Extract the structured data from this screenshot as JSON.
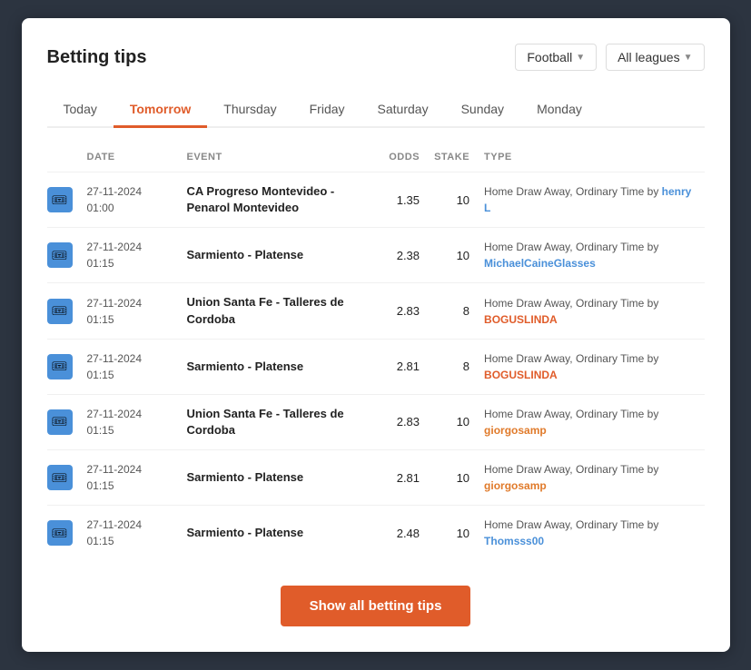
{
  "header": {
    "title": "Betting tips",
    "filters": {
      "league_label": "Football",
      "allleagues_label": "All leagues"
    }
  },
  "tabs": [
    {
      "id": "today",
      "label": "Today",
      "active": false
    },
    {
      "id": "tomorrow",
      "label": "Tomorrow",
      "active": true
    },
    {
      "id": "thursday",
      "label": "Thursday",
      "active": false
    },
    {
      "id": "friday",
      "label": "Friday",
      "active": false
    },
    {
      "id": "saturday",
      "label": "Saturday",
      "active": false
    },
    {
      "id": "sunday",
      "label": "Sunday",
      "active": false
    },
    {
      "id": "monday",
      "label": "Monday",
      "active": false
    }
  ],
  "table": {
    "columns": [
      "DATE",
      "EVENT",
      "ODDS",
      "STAKE",
      "TYPE"
    ],
    "rows": [
      {
        "date": "27-11-2024",
        "time": "01:00",
        "event": "CA Progreso Montevideo - Penarol Montevideo",
        "odds": "1.35",
        "stake": "10",
        "type_prefix": "Home Draw Away, Ordinary Time by ",
        "author": "henry L",
        "author_color": "blue"
      },
      {
        "date": "27-11-2024",
        "time": "01:15",
        "event": "Sarmiento - Platense",
        "odds": "2.38",
        "stake": "10",
        "type_prefix": "Home Draw Away, Ordinary Time by ",
        "author": "MichaelCaineGlasses",
        "author_color": "blue"
      },
      {
        "date": "27-11-2024",
        "time": "01:15",
        "event": "Union Santa Fe - Talleres de Cordoba",
        "odds": "2.83",
        "stake": "8",
        "type_prefix": "Home Draw Away, Ordinary Time by ",
        "author": "BOGUSLINDA",
        "author_color": "red"
      },
      {
        "date": "27-11-2024",
        "time": "01:15",
        "event": "Sarmiento - Platense",
        "odds": "2.81",
        "stake": "8",
        "type_prefix": "Home Draw Away, Ordinary Time by ",
        "author": "BOGUSLINDA",
        "author_color": "red"
      },
      {
        "date": "27-11-2024",
        "time": "01:15",
        "event": "Union Santa Fe - Talleres de Cordoba",
        "odds": "2.83",
        "stake": "10",
        "type_prefix": "Home Draw Away, Ordinary Time by ",
        "author": "giorgosamp",
        "author_color": "orange"
      },
      {
        "date": "27-11-2024",
        "time": "01:15",
        "event": "Sarmiento - Platense",
        "odds": "2.81",
        "stake": "10",
        "type_prefix": "Home Draw Away, Ordinary Time by ",
        "author": "giorgosamp",
        "author_color": "orange"
      },
      {
        "date": "27-11-2024",
        "time": "01:15",
        "event": "Sarmiento - Platense",
        "odds": "2.48",
        "stake": "10",
        "type_prefix": "Home Draw Away, Ordinary Time by ",
        "author": "Thomsss00",
        "author_color": "blue"
      }
    ]
  },
  "show_btn_label": "Show all betting tips"
}
